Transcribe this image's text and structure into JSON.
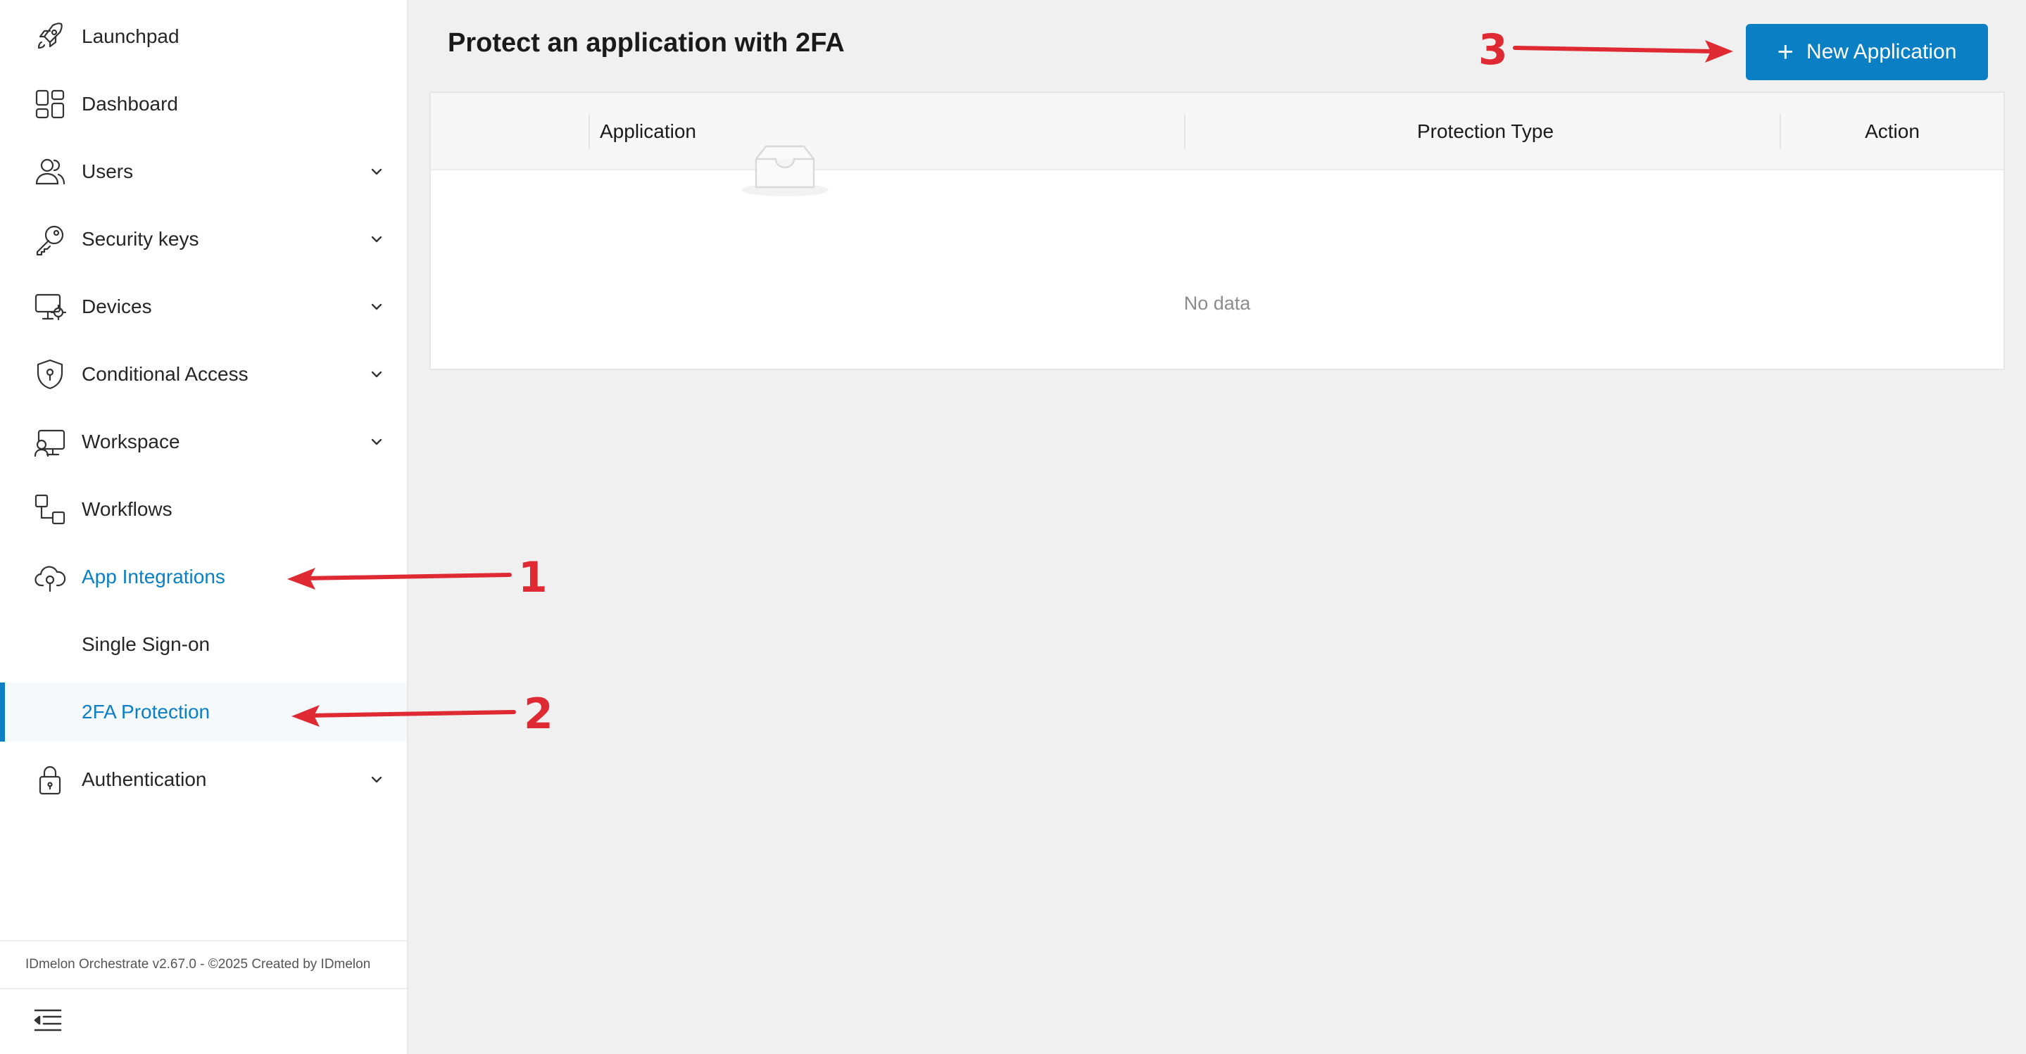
{
  "sidebar": {
    "items": [
      {
        "label": "Launchpad",
        "icon": "rocket-icon"
      },
      {
        "label": "Dashboard",
        "icon": "dashboard-icon"
      },
      {
        "label": "Users",
        "icon": "users-icon"
      },
      {
        "label": "Security keys",
        "icon": "key-icon"
      },
      {
        "label": "Devices",
        "icon": "device-icon"
      },
      {
        "label": "Conditional Access",
        "icon": "shield-icon"
      },
      {
        "label": "Workspace",
        "icon": "workspace-icon"
      },
      {
        "label": "Workflows",
        "icon": "workflow-icon"
      },
      {
        "label": "App Integrations",
        "icon": "cloud-app-icon"
      },
      {
        "label": "Single Sign-on"
      },
      {
        "label": "2FA Protection"
      },
      {
        "label": "Authentication",
        "icon": "lock-icon"
      }
    ],
    "active_item": "2FA Protection",
    "footer": "IDmelon Orchestrate v2.67.0 - ©2025 Created by IDmelon"
  },
  "main": {
    "title": "Protect an application with 2FA",
    "new_button_label": "New Application",
    "table": {
      "columns": [
        "Application",
        "Protection Type",
        "Action"
      ],
      "rows": [],
      "empty_text": "No data"
    }
  },
  "annotations": [
    "1",
    "2",
    "3"
  ],
  "colors": {
    "accent": "#0a7fc3",
    "annotation": "#e02a33",
    "background": "#f0f0f0"
  }
}
